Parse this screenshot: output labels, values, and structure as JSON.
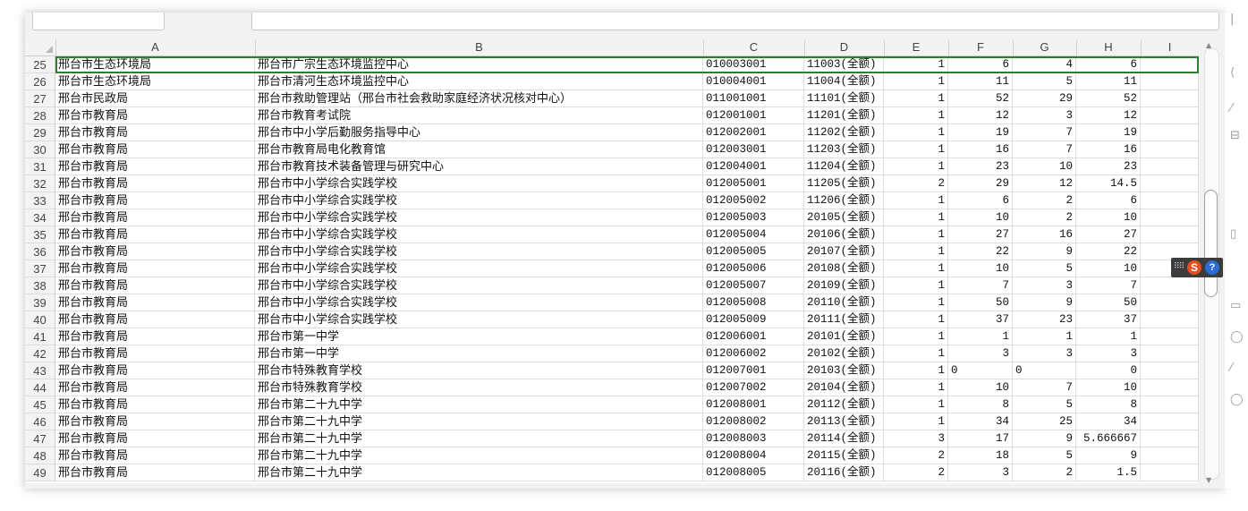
{
  "columns": [
    "A",
    "B",
    "C",
    "D",
    "E",
    "F",
    "G",
    "H",
    "I"
  ],
  "rows": [
    {
      "n": "25",
      "a": "邢台市生态环境局",
      "b": "邢台市广宗生态环境监控中心",
      "c": "010003001",
      "d": "11003(全额)",
      "e": "1",
      "f": "6",
      "g": "4",
      "h": "6"
    },
    {
      "n": "26",
      "a": "邢台市生态环境局",
      "b": "邢台市清河生态环境监控中心",
      "c": "010004001",
      "d": "11004(全额)",
      "e": "1",
      "f": "11",
      "g": "5",
      "h": "11"
    },
    {
      "n": "27",
      "a": "邢台市民政局",
      "b": "邢台市救助管理站（邢台市社会救助家庭经济状况核对中心）",
      "c": "011001001",
      "d": "11101(全额)",
      "e": "1",
      "f": "52",
      "g": "29",
      "h": "52"
    },
    {
      "n": "28",
      "a": "邢台市教育局",
      "b": "邢台市教育考试院",
      "c": "012001001",
      "d": "11201(全额)",
      "e": "1",
      "f": "12",
      "g": "3",
      "h": "12"
    },
    {
      "n": "29",
      "a": "邢台市教育局",
      "b": "邢台市中小学后勤服务指导中心",
      "c": "012002001",
      "d": "11202(全额)",
      "e": "1",
      "f": "19",
      "g": "7",
      "h": "19"
    },
    {
      "n": "30",
      "a": "邢台市教育局",
      "b": "邢台市教育局电化教育馆",
      "c": "012003001",
      "d": "11203(全额)",
      "e": "1",
      "f": "16",
      "g": "7",
      "h": "16"
    },
    {
      "n": "31",
      "a": "邢台市教育局",
      "b": "邢台市教育技术装备管理与研究中心",
      "c": "012004001",
      "d": "11204(全额)",
      "e": "1",
      "f": "23",
      "g": "10",
      "h": "23"
    },
    {
      "n": "32",
      "a": "邢台市教育局",
      "b": "邢台市中小学综合实践学校",
      "c": "012005001",
      "d": "11205(全额)",
      "e": "2",
      "f": "29",
      "g": "12",
      "h": "14.5"
    },
    {
      "n": "33",
      "a": "邢台市教育局",
      "b": "邢台市中小学综合实践学校",
      "c": "012005002",
      "d": "11206(全额)",
      "e": "1",
      "f": "6",
      "g": "2",
      "h": "6"
    },
    {
      "n": "34",
      "a": "邢台市教育局",
      "b": "邢台市中小学综合实践学校",
      "c": "012005003",
      "d": "20105(全额)",
      "e": "1",
      "f": "10",
      "g": "2",
      "h": "10"
    },
    {
      "n": "35",
      "a": "邢台市教育局",
      "b": "邢台市中小学综合实践学校",
      "c": "012005004",
      "d": "20106(全额)",
      "e": "1",
      "f": "27",
      "g": "16",
      "h": "27"
    },
    {
      "n": "36",
      "a": "邢台市教育局",
      "b": "邢台市中小学综合实践学校",
      "c": "012005005",
      "d": "20107(全额)",
      "e": "1",
      "f": "22",
      "g": "9",
      "h": "22"
    },
    {
      "n": "37",
      "a": "邢台市教育局",
      "b": "邢台市中小学综合实践学校",
      "c": "012005006",
      "d": "20108(全额)",
      "e": "1",
      "f": "10",
      "g": "5",
      "h": "10"
    },
    {
      "n": "38",
      "a": "邢台市教育局",
      "b": "邢台市中小学综合实践学校",
      "c": "012005007",
      "d": "20109(全额)",
      "e": "1",
      "f": "7",
      "g": "3",
      "h": "7"
    },
    {
      "n": "39",
      "a": "邢台市教育局",
      "b": "邢台市中小学综合实践学校",
      "c": "012005008",
      "d": "20110(全额)",
      "e": "1",
      "f": "50",
      "g": "9",
      "h": "50"
    },
    {
      "n": "40",
      "a": "邢台市教育局",
      "b": "邢台市中小学综合实践学校",
      "c": "012005009",
      "d": "20111(全额)",
      "e": "1",
      "f": "37",
      "g": "23",
      "h": "37"
    },
    {
      "n": "41",
      "a": "邢台市教育局",
      "b": "邢台市第一中学",
      "c": "012006001",
      "d": "20101(全额)",
      "e": "1",
      "f": "1",
      "g": "1",
      "h": "1"
    },
    {
      "n": "42",
      "a": "邢台市教育局",
      "b": "邢台市第一中学",
      "c": "012006002",
      "d": "20102(全额)",
      "e": "1",
      "f": "3",
      "g": "3",
      "h": "3"
    },
    {
      "n": "43",
      "a": "邢台市教育局",
      "b": "邢台市特殊教育学校",
      "c": "012007001",
      "d": "20103(全额)",
      "e": "1",
      "f": "0",
      "g": "0",
      "h": "0",
      "fl": true,
      "gl": true
    },
    {
      "n": "44",
      "a": "邢台市教育局",
      "b": "邢台市特殊教育学校",
      "c": "012007002",
      "d": "20104(全额)",
      "e": "1",
      "f": "10",
      "g": "7",
      "h": "10"
    },
    {
      "n": "45",
      "a": "邢台市教育局",
      "b": "邢台市第二十九中学",
      "c": "012008001",
      "d": "20112(全额)",
      "e": "1",
      "f": "8",
      "g": "5",
      "h": "8"
    },
    {
      "n": "46",
      "a": "邢台市教育局",
      "b": "邢台市第二十九中学",
      "c": "012008002",
      "d": "20113(全额)",
      "e": "1",
      "f": "34",
      "g": "25",
      "h": "34"
    },
    {
      "n": "47",
      "a": "邢台市教育局",
      "b": "邢台市第二十九中学",
      "c": "012008003",
      "d": "20114(全额)",
      "e": "3",
      "f": "17",
      "g": "9",
      "h": "5.666667"
    },
    {
      "n": "48",
      "a": "邢台市教育局",
      "b": "邢台市第二十九中学",
      "c": "012008004",
      "d": "20115(全额)",
      "e": "2",
      "f": "18",
      "g": "5",
      "h": "9"
    },
    {
      "n": "49",
      "a": "邢台市教育局",
      "b": "邢台市第二十九中学",
      "c": "012008005",
      "d": "20116(全额)",
      "e": "2",
      "f": "3",
      "g": "2",
      "h": "1.5"
    }
  ],
  "selection_color": "#2e7d32",
  "icons": {
    "ime_logo": "sogou-s-icon",
    "ime_help": "help-icon"
  },
  "ime": {
    "logo_char": "S",
    "help_char": "?"
  }
}
